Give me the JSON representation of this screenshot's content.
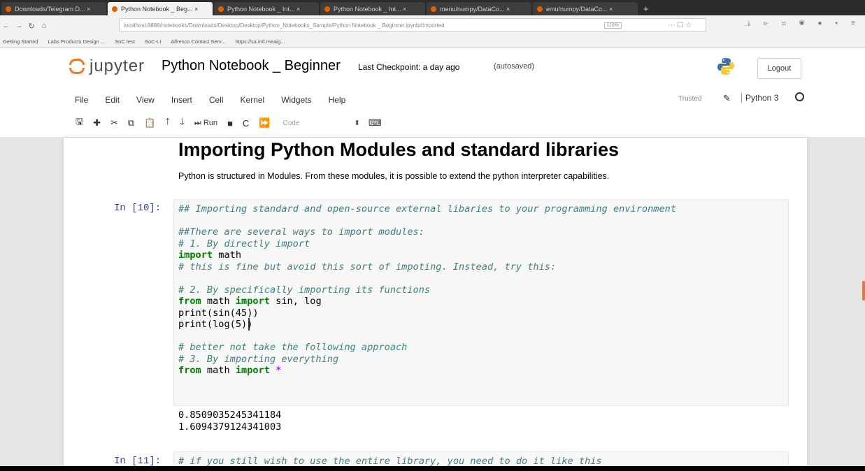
{
  "browser": {
    "tabs": [
      {
        "label": "Downloads/Telegram D... ×",
        "active": false
      },
      {
        "label": "Python Notebook _ Beg... ×",
        "active": true
      },
      {
        "label": "Python Notebook _ Int... ×",
        "active": false
      },
      {
        "label": "Python Notebook _ Int... ×",
        "active": false
      },
      {
        "label": "menu/numpy/DataCo... ×",
        "active": false
      },
      {
        "label": "emu/numpy/DataCo... ×",
        "active": false
      }
    ],
    "new_tab": "+",
    "url": "localhost:8888/notebooks/Downloads/Desktop/Desktop/Python_Notebooks_Sample/Python Notebook _ Beginner.ipynb#Imported",
    "zoom": "110%",
    "bookmarks": [
      "Getting Started",
      "Labs Products Design ...",
      "SoC test",
      "SoC-LI",
      "Alfresco Contact Serv...",
      "https://sa.intl.meaig..."
    ]
  },
  "jupyter": {
    "logo_text": "jupyter",
    "notebook_title": "Python Notebook _ Beginner",
    "checkpoint": "Last Checkpoint: a day ago",
    "autosaved": "(autosaved)",
    "logout": "Logout",
    "menu": [
      "File",
      "Edit",
      "View",
      "Insert",
      "Cell",
      "Kernel",
      "Widgets",
      "Help"
    ],
    "trusted": "Trusted",
    "kernel_name": "Python 3",
    "toolbar": {
      "run_label": "Run",
      "cell_type": "Code"
    }
  },
  "notebook": {
    "heading": "Importing Python Modules and standard libraries",
    "paragraph": "Python is structured in Modules. From these modules, it is possible to extend the python interpreter capabilities.",
    "cell1_prompt": "In [10]:",
    "cell1_output": [
      "0.8509035245341184",
      "1.6094379124341003"
    ],
    "cell2_prompt": "In [11]:"
  },
  "colors": {
    "jupyter_orange": "#f37626",
    "prompt_blue": "#303f9f",
    "comment": "#408080",
    "keyword": "#008000"
  }
}
